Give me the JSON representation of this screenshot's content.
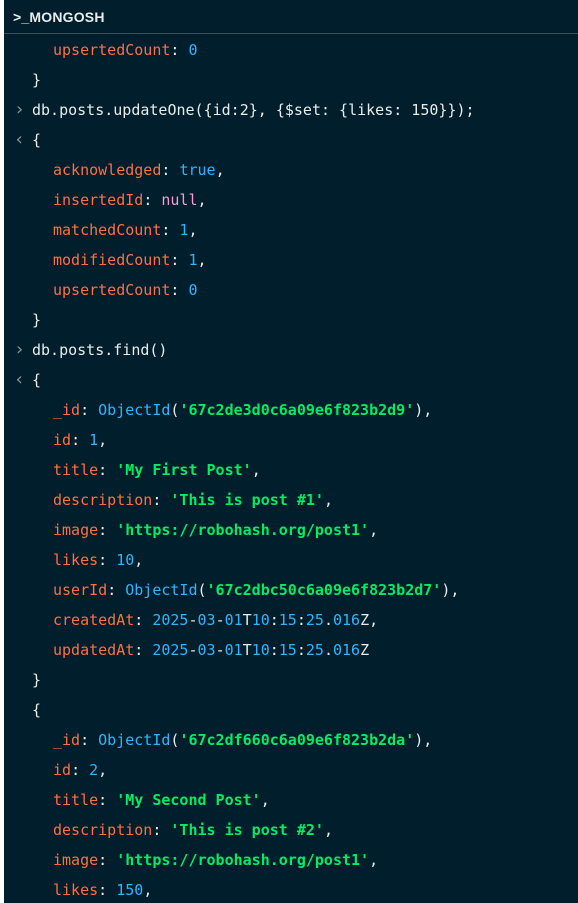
{
  "header": {
    "title": ">_MONGOSH"
  },
  "icons": {
    "prompt": "chevron-right-icon",
    "result": "chevron-left-icon"
  },
  "colors": {
    "background": "#001e2b",
    "key": "#ff6f44",
    "number": "#2db6ff",
    "string": "#00ed64",
    "null": "#f39fd4"
  },
  "lines": [
    {
      "kind": "kv",
      "indent": 1,
      "key": "upsertedCount",
      "vtype": "num",
      "value": "0",
      "comma": false
    },
    {
      "kind": "brace",
      "indent": 0,
      "text": "}"
    },
    {
      "kind": "cmd",
      "text": "db.posts.updateOne({id:2}, {$set: {likes: 150}});"
    },
    {
      "kind": "brace",
      "indent": 0,
      "marker": "result",
      "text": "{"
    },
    {
      "kind": "kv",
      "indent": 1,
      "key": "acknowledged",
      "vtype": "bool",
      "value": "true",
      "comma": true
    },
    {
      "kind": "kv",
      "indent": 1,
      "key": "insertedId",
      "vtype": "nul",
      "value": "null",
      "comma": true
    },
    {
      "kind": "kv",
      "indent": 1,
      "key": "matchedCount",
      "vtype": "num",
      "value": "1",
      "comma": true
    },
    {
      "kind": "kv",
      "indent": 1,
      "key": "modifiedCount",
      "vtype": "num",
      "value": "1",
      "comma": true
    },
    {
      "kind": "kv",
      "indent": 1,
      "key": "upsertedCount",
      "vtype": "num",
      "value": "0",
      "comma": false
    },
    {
      "kind": "brace",
      "indent": 0,
      "text": "}"
    },
    {
      "kind": "cmd",
      "text": "db.posts.find()"
    },
    {
      "kind": "brace",
      "indent": 0,
      "marker": "result",
      "text": "{"
    },
    {
      "kind": "kv",
      "indent": 1,
      "key": "_id",
      "vtype": "oid",
      "value": "67c2de3d0c6a09e6f823b2d9",
      "comma": true
    },
    {
      "kind": "kv",
      "indent": 1,
      "key": "id",
      "vtype": "num",
      "value": "1",
      "comma": true
    },
    {
      "kind": "kv",
      "indent": 1,
      "key": "title",
      "vtype": "str",
      "value": "'My First Post'",
      "comma": true
    },
    {
      "kind": "kv",
      "indent": 1,
      "key": "description",
      "vtype": "str",
      "value": "'This is post #1'",
      "comma": true
    },
    {
      "kind": "kv",
      "indent": 1,
      "key": "image",
      "vtype": "str",
      "value": "'https://robohash.org/post1'",
      "comma": true
    },
    {
      "kind": "kv",
      "indent": 1,
      "key": "likes",
      "vtype": "num",
      "value": "10",
      "comma": true
    },
    {
      "kind": "kv",
      "indent": 1,
      "key": "userId",
      "vtype": "oid",
      "value": "67c2dbc50c6a09e6f823b2d7",
      "comma": true
    },
    {
      "kind": "kv",
      "indent": 1,
      "key": "createdAt",
      "vtype": "date",
      "value": "2025-03-01T10:15:25.016Z",
      "comma": true
    },
    {
      "kind": "kv",
      "indent": 1,
      "key": "updatedAt",
      "vtype": "date",
      "value": "2025-03-01T10:15:25.016Z",
      "comma": false
    },
    {
      "kind": "brace",
      "indent": 0,
      "text": "}"
    },
    {
      "kind": "brace",
      "indent": 0,
      "text": "{"
    },
    {
      "kind": "kv",
      "indent": 1,
      "key": "_id",
      "vtype": "oid",
      "value": "67c2df660c6a09e6f823b2da",
      "comma": true
    },
    {
      "kind": "kv",
      "indent": 1,
      "key": "id",
      "vtype": "num",
      "value": "2",
      "comma": true
    },
    {
      "kind": "kv",
      "indent": 1,
      "key": "title",
      "vtype": "str",
      "value": "'My Second Post'",
      "comma": true
    },
    {
      "kind": "kv",
      "indent": 1,
      "key": "description",
      "vtype": "str",
      "value": "'This is post #2'",
      "comma": true
    },
    {
      "kind": "kv",
      "indent": 1,
      "key": "image",
      "vtype": "str",
      "value": "'https://robohash.org/post1'",
      "comma": true
    },
    {
      "kind": "kv",
      "indent": 1,
      "key": "likes",
      "vtype": "num",
      "value": "150",
      "comma": true
    }
  ]
}
